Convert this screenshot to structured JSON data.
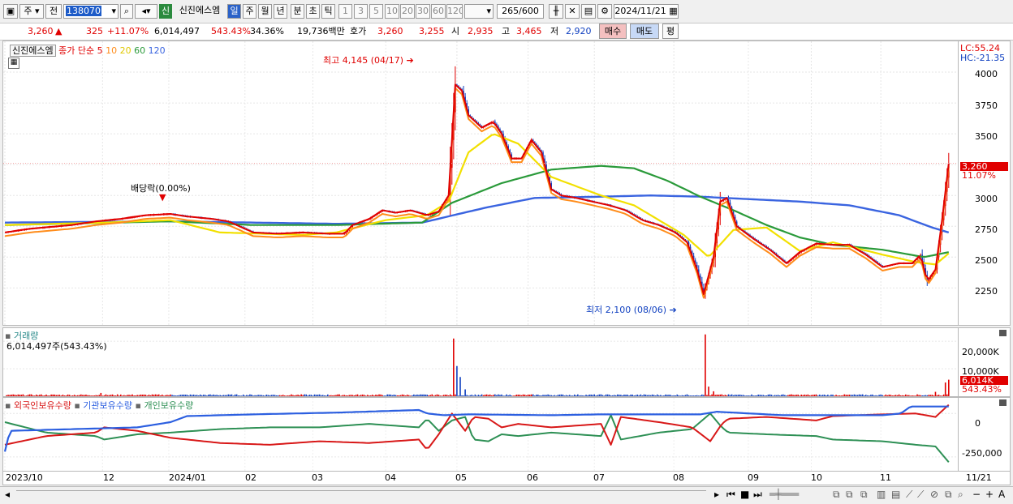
{
  "toolbar": {
    "period_type": "주",
    "prev_label": "전",
    "code": "138070",
    "credit_badge": "신",
    "stock_name": "신진에스엠",
    "periods": [
      "일",
      "주",
      "월",
      "년",
      "분",
      "초",
      "틱"
    ],
    "active_period": "일",
    "minute_options": [
      "1",
      "3",
      "5",
      "10",
      "20",
      "30",
      "60",
      "120"
    ],
    "count": "265",
    "count_total": "/600",
    "date": "2024/11/21"
  },
  "quote": {
    "price": "3,260",
    "change_arrow": "▲",
    "change": "325",
    "change_pct": "+11.07%",
    "volume": "6,014,497",
    "volume_ratio": "543.43%",
    "turnover": "34.36%",
    "amount": "19,736백만",
    "bid_label": "호가",
    "ask": "3,260",
    "bid": "3,255",
    "open_label": "시",
    "open": "2,935",
    "high_label": "고",
    "high": "3,465",
    "low_label": "저",
    "low": "2,920",
    "buy_label": "매수",
    "sell_label": "매도",
    "eval_label": "평"
  },
  "price_panel": {
    "name_tag": "신진에스엠",
    "ma_title": "종가 단순",
    "ma_periods": [
      "5",
      "10",
      "20",
      "60",
      "120"
    ],
    "lc_label": "LC:55.24",
    "hc_label": "HC:-21.35",
    "high_note": "최고 4,145 (04/17)",
    "low_note": "최저 2,100 (08/06)",
    "dividend_note": "배당락(0.00%)",
    "current_price_tag": "3,260",
    "current_pct_tag": "11.07%"
  },
  "volume_panel": {
    "title": "거래량",
    "value_line": "6,014,497주(543.43%)",
    "current_tag": "6,014K",
    "current_pct_tag": "543.43%"
  },
  "holdings_panel": {
    "labels": [
      "외국인보유수량",
      "기관보유수량",
      "개인보유수량"
    ]
  },
  "colors": {
    "up": "#e00000",
    "down": "#1040c0",
    "ma5": "#e00000",
    "ma10": "#ff8c1a",
    "ma20": "#f2e000",
    "ma60": "#2a9a3a",
    "ma120": "#3a64e0",
    "foreign": "#d81818",
    "institution": "#2c5fe0",
    "individual": "#2e9055"
  },
  "chart_data": {
    "type": "candlestick",
    "x_ticks": [
      "2023/10",
      "12",
      "2024/01",
      "02",
      "03",
      "04",
      "05",
      "06",
      "07",
      "08",
      "09",
      "10",
      "11",
      "11/21"
    ],
    "price_axis": {
      "ticks": [
        2250,
        2500,
        2750,
        3000,
        3250,
        3500,
        3750,
        4000
      ],
      "ylim": [
        1950,
        4250
      ]
    },
    "volume_axis": {
      "ticks": [
        "10,000K",
        "20,000K"
      ],
      "ylim": [
        0,
        23000
      ]
    },
    "holdings_axis": {
      "ticks": [
        "0",
        "-250,000"
      ]
    },
    "last_close": 3260,
    "high": {
      "value": 4145,
      "date": "04/17"
    },
    "low": {
      "value": 2100,
      "date": "08/06"
    },
    "price_path": [
      [
        0,
        2700
      ],
      [
        15,
        2730
      ],
      [
        40,
        2760
      ],
      [
        55,
        2790
      ],
      [
        70,
        2810
      ],
      [
        85,
        2840
      ],
      [
        100,
        2850
      ],
      [
        110,
        2830
      ],
      [
        125,
        2810
      ],
      [
        135,
        2790
      ],
      [
        150,
        2700
      ],
      [
        165,
        2690
      ],
      [
        180,
        2700
      ],
      [
        195,
        2690
      ],
      [
        205,
        2690
      ],
      [
        210,
        2760
      ],
      [
        220,
        2810
      ],
      [
        228,
        2880
      ],
      [
        236,
        2860
      ],
      [
        245,
        2880
      ],
      [
        255,
        2840
      ],
      [
        262,
        2870
      ],
      [
        268,
        3000
      ],
      [
        272,
        3900
      ],
      [
        276,
        3850
      ],
      [
        280,
        3650
      ],
      [
        288,
        3550
      ],
      [
        295,
        3600
      ],
      [
        300,
        3500
      ],
      [
        306,
        3300
      ],
      [
        312,
        3300
      ],
      [
        318,
        3450
      ],
      [
        324,
        3350
      ],
      [
        330,
        3050
      ],
      [
        336,
        3000
      ],
      [
        345,
        2980
      ],
      [
        355,
        2950
      ],
      [
        365,
        2920
      ],
      [
        375,
        2880
      ],
      [
        385,
        2800
      ],
      [
        395,
        2760
      ],
      [
        405,
        2700
      ],
      [
        412,
        2620
      ],
      [
        418,
        2400
      ],
      [
        422,
        2200
      ],
      [
        428,
        2500
      ],
      [
        432,
        2950
      ],
      [
        436,
        2980
      ],
      [
        442,
        2750
      ],
      [
        452,
        2650
      ],
      [
        462,
        2560
      ],
      [
        472,
        2450
      ],
      [
        480,
        2540
      ],
      [
        490,
        2610
      ],
      [
        500,
        2600
      ],
      [
        510,
        2600
      ],
      [
        520,
        2520
      ],
      [
        530,
        2420
      ],
      [
        540,
        2450
      ],
      [
        548,
        2450
      ],
      [
        553,
        2520
      ],
      [
        557,
        2300
      ],
      [
        562,
        2400
      ],
      [
        566,
        2800
      ],
      [
        570,
        3260
      ]
    ],
    "ma20_path": [
      [
        0,
        2760
      ],
      [
        60,
        2780
      ],
      [
        100,
        2800
      ],
      [
        130,
        2700
      ],
      [
        180,
        2680
      ],
      [
        200,
        2700
      ],
      [
        230,
        2800
      ],
      [
        255,
        2840
      ],
      [
        268,
        2950
      ],
      [
        280,
        3350
      ],
      [
        295,
        3500
      ],
      [
        310,
        3420
      ],
      [
        330,
        3150
      ],
      [
        360,
        3000
      ],
      [
        380,
        2920
      ],
      [
        395,
        2800
      ],
      [
        410,
        2680
      ],
      [
        425,
        2500
      ],
      [
        440,
        2720
      ],
      [
        460,
        2740
      ],
      [
        480,
        2550
      ],
      [
        500,
        2620
      ],
      [
        530,
        2520
      ],
      [
        550,
        2460
      ],
      [
        562,
        2440
      ],
      [
        570,
        2530
      ]
    ],
    "ma60_path": [
      [
        0,
        2760
      ],
      [
        100,
        2790
      ],
      [
        150,
        2760
      ],
      [
        200,
        2760
      ],
      [
        252,
        2780
      ],
      [
        270,
        2940
      ],
      [
        300,
        3100
      ],
      [
        330,
        3210
      ],
      [
        360,
        3240
      ],
      [
        380,
        3220
      ],
      [
        400,
        3120
      ],
      [
        420,
        2990
      ],
      [
        440,
        2880
      ],
      [
        460,
        2760
      ],
      [
        480,
        2660
      ],
      [
        500,
        2600
      ],
      [
        530,
        2560
      ],
      [
        555,
        2500
      ],
      [
        570,
        2540
      ]
    ],
    "ma120_path": [
      [
        0,
        2780
      ],
      [
        100,
        2790
      ],
      [
        200,
        2770
      ],
      [
        252,
        2780
      ],
      [
        290,
        2900
      ],
      [
        320,
        2980
      ],
      [
        360,
        2990
      ],
      [
        390,
        3000
      ],
      [
        420,
        2990
      ],
      [
        450,
        2970
      ],
      [
        480,
        2950
      ],
      [
        510,
        2920
      ],
      [
        540,
        2840
      ],
      [
        560,
        2740
      ],
      [
        570,
        2700
      ]
    ],
    "volume_spikes": [
      [
        58,
        1200
      ],
      [
        271,
        21000
      ],
      [
        273,
        11000
      ],
      [
        275,
        7000
      ],
      [
        278,
        2500
      ],
      [
        423,
        22500
      ],
      [
        425,
        3500
      ],
      [
        428,
        1800
      ],
      [
        562,
        1600
      ],
      [
        568,
        5000
      ],
      [
        570,
        6014
      ]
    ],
    "foreign_path": [
      [
        0,
        -180000
      ],
      [
        25,
        -130000
      ],
      [
        55,
        -110000
      ],
      [
        60,
        -80000
      ],
      [
        80,
        -100000
      ],
      [
        100,
        -140000
      ],
      [
        130,
        -170000
      ],
      [
        160,
        -180000
      ],
      [
        190,
        -160000
      ],
      [
        220,
        -170000
      ],
      [
        250,
        -150000
      ],
      [
        255,
        -210000
      ],
      [
        262,
        -120000
      ],
      [
        270,
        0
      ],
      [
        278,
        -100000
      ],
      [
        283,
        -20000
      ],
      [
        292,
        -30000
      ],
      [
        300,
        -80000
      ],
      [
        310,
        -60000
      ],
      [
        330,
        -80000
      ],
      [
        360,
        -60000
      ],
      [
        366,
        -180000
      ],
      [
        372,
        -20000
      ],
      [
        395,
        -50000
      ],
      [
        415,
        -80000
      ],
      [
        426,
        -160000
      ],
      [
        433,
        -60000
      ],
      [
        437,
        -30000
      ],
      [
        460,
        -20000
      ],
      [
        490,
        -40000
      ],
      [
        500,
        -15000
      ],
      [
        530,
        -5000
      ],
      [
        550,
        0
      ],
      [
        562,
        -20000
      ],
      [
        570,
        50000
      ]
    ],
    "institution_path": [
      [
        0,
        -220000
      ],
      [
        3,
        -100000
      ],
      [
        80,
        -80000
      ],
      [
        100,
        -50000
      ],
      [
        110,
        -15000
      ],
      [
        150,
        -5000
      ],
      [
        200,
        5000
      ],
      [
        250,
        20000
      ],
      [
        255,
        0
      ],
      [
        265,
        -10000
      ],
      [
        280,
        -5000
      ],
      [
        330,
        -10000
      ],
      [
        360,
        -5000
      ],
      [
        420,
        -5000
      ],
      [
        430,
        10000
      ],
      [
        470,
        -10000
      ],
      [
        500,
        -10000
      ],
      [
        530,
        -10000
      ],
      [
        541,
        0
      ],
      [
        547,
        40000
      ],
      [
        570,
        40000
      ]
    ],
    "individual_path": [
      [
        0,
        -50000
      ],
      [
        25,
        -110000
      ],
      [
        55,
        -130000
      ],
      [
        60,
        -150000
      ],
      [
        80,
        -120000
      ],
      [
        100,
        -110000
      ],
      [
        130,
        -90000
      ],
      [
        160,
        -80000
      ],
      [
        190,
        -80000
      ],
      [
        220,
        -60000
      ],
      [
        250,
        -80000
      ],
      [
        255,
        -30000
      ],
      [
        262,
        -100000
      ],
      [
        270,
        -40000
      ],
      [
        278,
        -20000
      ],
      [
        283,
        -150000
      ],
      [
        292,
        -160000
      ],
      [
        300,
        -120000
      ],
      [
        310,
        -130000
      ],
      [
        330,
        -110000
      ],
      [
        360,
        -130000
      ],
      [
        366,
        -10000
      ],
      [
        372,
        -150000
      ],
      [
        395,
        -110000
      ],
      [
        415,
        -90000
      ],
      [
        426,
        0
      ],
      [
        433,
        -80000
      ],
      [
        437,
        -110000
      ],
      [
        460,
        -120000
      ],
      [
        490,
        -130000
      ],
      [
        500,
        -150000
      ],
      [
        530,
        -160000
      ],
      [
        550,
        -180000
      ],
      [
        562,
        -190000
      ],
      [
        570,
        -280000
      ]
    ]
  }
}
